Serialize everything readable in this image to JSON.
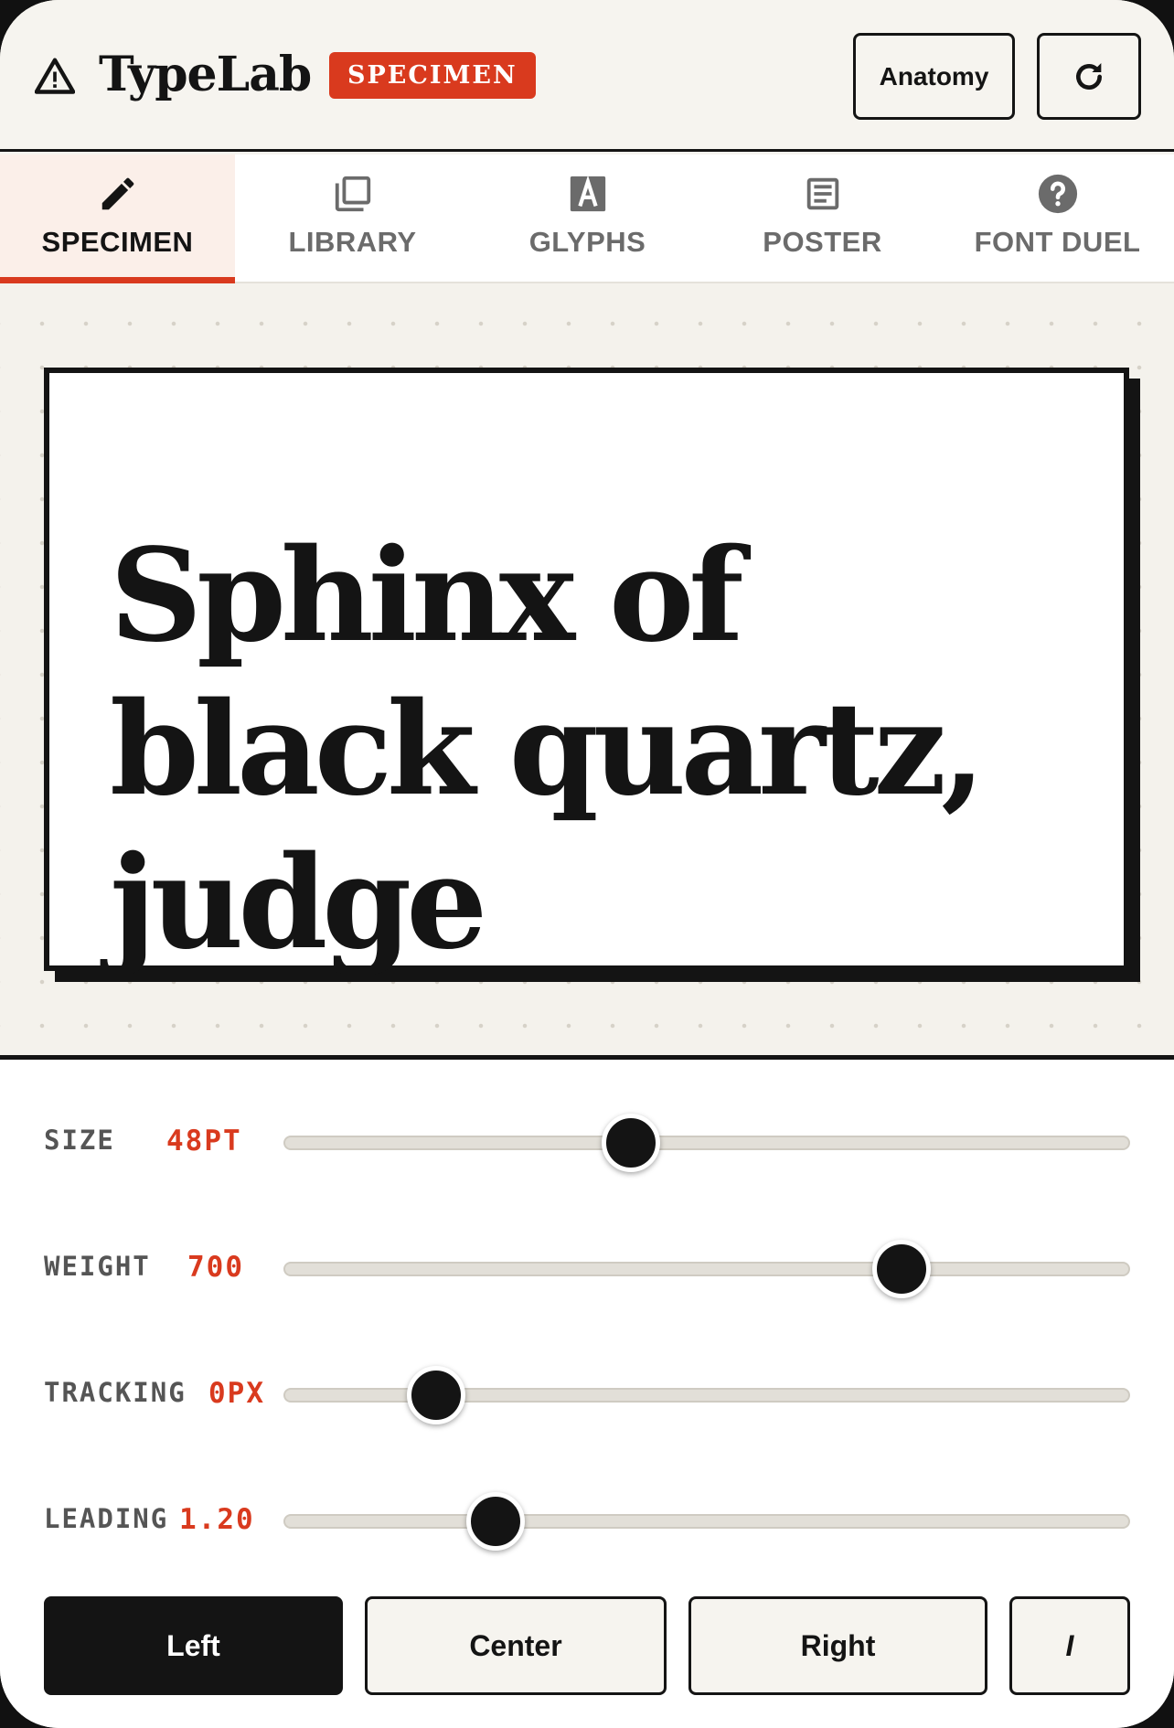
{
  "header": {
    "brand": "TypeLab",
    "badge": "SPECIMEN",
    "anatomy_label": "Anatomy",
    "icons": [
      "warning-triangle-icon",
      "refresh-icon"
    ]
  },
  "tabs": [
    {
      "label": "SPECIMEN",
      "icon": "pencil-icon",
      "active": true
    },
    {
      "label": "LIBRARY",
      "icon": "library-icon",
      "active": false
    },
    {
      "label": "GLYPHS",
      "icon": "glyph-a-icon",
      "active": false
    },
    {
      "label": "POSTER",
      "icon": "poster-icon",
      "active": false
    },
    {
      "label": "FONT DUEL",
      "icon": "help-circle-icon",
      "active": false
    }
  ],
  "specimen": {
    "text": "Sphinx of black quartz, judge"
  },
  "controls": {
    "size": {
      "name": "SIZE",
      "value": "48PT",
      "level": 0.41
    },
    "weight": {
      "name": "WEIGHT",
      "value": "700",
      "level": 0.73
    },
    "tracking": {
      "name": "TRACKING",
      "value": "0PX",
      "level": 0.18
    },
    "leading": {
      "name": "LEADING",
      "value": "1.20",
      "level": 0.25
    }
  },
  "alignment": {
    "left": "Left",
    "center": "Center",
    "right": "Right",
    "italic": "I",
    "selected": "left"
  },
  "colors": {
    "accent": "#d93a1e",
    "ink": "#141414",
    "paper": "#f6f4ef"
  }
}
